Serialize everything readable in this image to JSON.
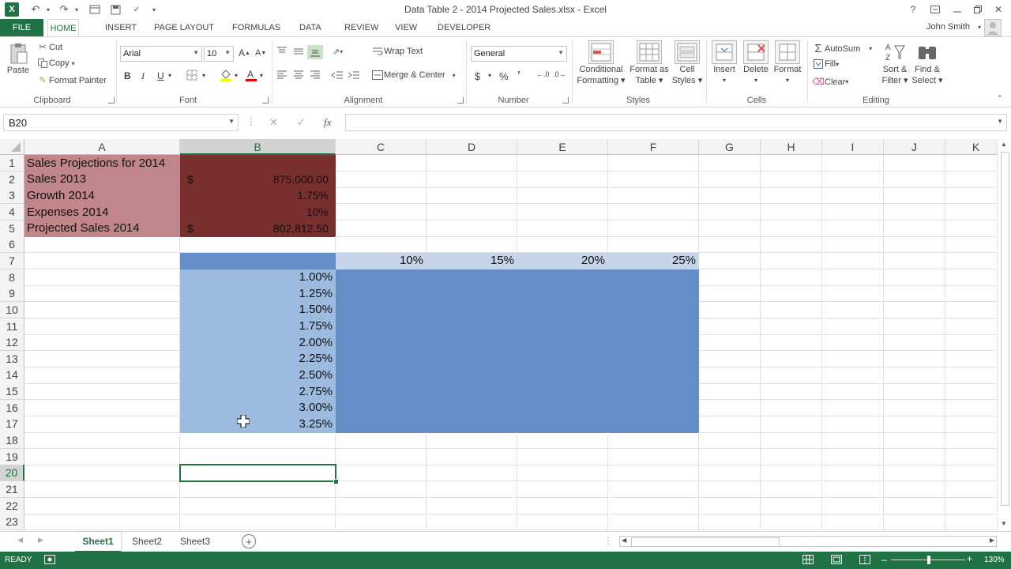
{
  "title_bar": {
    "app_logo": "X",
    "document_title": "Data Table 2 - 2014 Projected Sales.xlsx - Excel",
    "help": "?",
    "icons": [
      "excel-logo-icon",
      "undo-icon",
      "redo-icon",
      "new-icon",
      "save-icon",
      "spelling-icon",
      "customize-qat-icon",
      "help-icon",
      "ribbon-display-icon",
      "minimize-icon",
      "restore-icon",
      "close-icon"
    ]
  },
  "tabs": [
    "FILE",
    "HOME",
    "INSERT",
    "PAGE LAYOUT",
    "FORMULAS",
    "DATA",
    "REVIEW",
    "VIEW",
    "DEVELOPER"
  ],
  "user": {
    "name": "John Smith"
  },
  "ribbon": {
    "clipboard": {
      "paste": "Paste",
      "cut": "Cut",
      "copy": "Copy",
      "format_painter": "Format Painter",
      "label": "Clipboard"
    },
    "font": {
      "name": "Arial",
      "size": "10",
      "bold": "B",
      "italic": "I",
      "underline": "U",
      "label": "Font"
    },
    "alignment": {
      "wrap_text": "Wrap Text",
      "merge_center": "Merge & Center",
      "label": "Alignment"
    },
    "number": {
      "format": "General",
      "currency": "$",
      "percent": "%",
      "comma": "’",
      "label": "Number"
    },
    "styles": {
      "conditional_formatting": [
        "Conditional",
        "Formatting"
      ],
      "format_as_table": [
        "Format as",
        "Table"
      ],
      "cell_styles": [
        "Cell",
        "Styles"
      ],
      "label": "Styles"
    },
    "cells": {
      "insert": "Insert",
      "delete": "Delete",
      "format": "Format",
      "label": "Cells"
    },
    "editing": {
      "autosum": "AutoSum",
      "fill": "Fill",
      "clear": "Clear",
      "sort_filter": [
        "Sort &",
        "Filter"
      ],
      "find_select": [
        "Find &",
        "Select"
      ],
      "label": "Editing"
    }
  },
  "formula_bar": {
    "name_box": "B20",
    "cancel": "✕",
    "enter": "✓",
    "fx": "fx",
    "value": ""
  },
  "columns": [
    "A",
    "B",
    "C",
    "D",
    "E",
    "F",
    "G",
    "H",
    "I",
    "J",
    "K"
  ],
  "rows": [
    "1",
    "2",
    "3",
    "4",
    "5",
    "6",
    "7",
    "8",
    "9",
    "10",
    "11",
    "12",
    "13",
    "14",
    "15",
    "16",
    "17",
    "18",
    "19",
    "20",
    "21",
    "22",
    "23"
  ],
  "cells": {
    "A1": "Sales Projections for 2014",
    "A2": "Sales 2013",
    "A3": "Growth 2014",
    "A4": "Expenses 2014",
    "A5": "Projected Sales 2014",
    "B2_symbol": "$",
    "B2": "875,000.00",
    "B3": "1.75%",
    "B4": "10%",
    "B5_symbol": "$",
    "B5": "802,812.50",
    "C7": "10%",
    "D7": "15%",
    "E7": "20%",
    "F7": "25%",
    "B8": "1.00%",
    "B9": "1.25%",
    "B10": "1.50%",
    "B11": "1.75%",
    "B12": "2.00%",
    "B13": "2.25%",
    "B14": "2.50%",
    "B15": "2.75%",
    "B16": "3.00%",
    "B17": "3.25%"
  },
  "sheets": [
    "Sheet1",
    "Sheet2",
    "Sheet3"
  ],
  "active_sheet": "Sheet1",
  "status": {
    "mode": "READY",
    "zoom": "130%"
  },
  "colors": {
    "excel_green": "#217346",
    "label_fill": "#c0868a",
    "value_fill": "#7a2f2f",
    "table_header_fill": "#c7d5ea",
    "table_input_fill": "#9dbadf",
    "table_body_fill": "#648fc6"
  }
}
